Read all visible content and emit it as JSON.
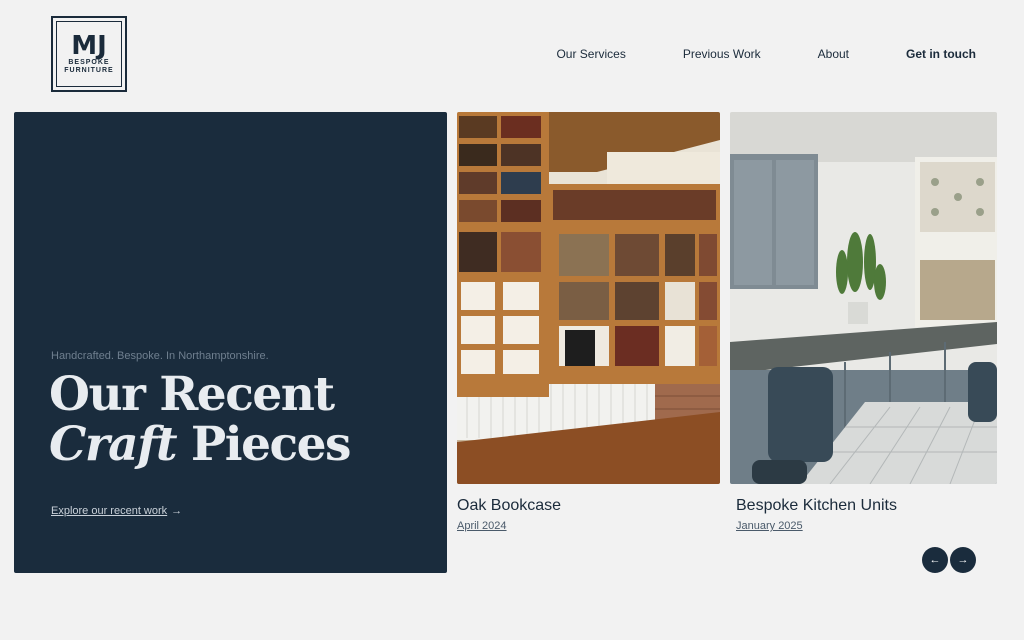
{
  "logo": {
    "mark": "MJ",
    "sub_line1": "BESPOKE",
    "sub_line2": "FURNITURE"
  },
  "nav": {
    "items": [
      "Our Services",
      "Previous Work",
      "About"
    ],
    "cta": "Get in touch"
  },
  "hero": {
    "tagline": "Handcrafted. Bespoke. In Northamptonshire.",
    "title_line1": "Our Recent",
    "title_italic": "Craft",
    "title_rest": " Pieces",
    "link": "Explore our recent work",
    "link_arrow": "→"
  },
  "cards": [
    {
      "title": "Oak Bookcase",
      "date": "April 2024"
    },
    {
      "title": "Bespoke Kitchen Units",
      "date": "January 2025"
    }
  ],
  "carousel": {
    "prev_icon": "←",
    "next_icon": "→"
  },
  "colors": {
    "navy": "#1a2c3d",
    "background": "#f2f2f2",
    "oak": "#b8793a"
  }
}
